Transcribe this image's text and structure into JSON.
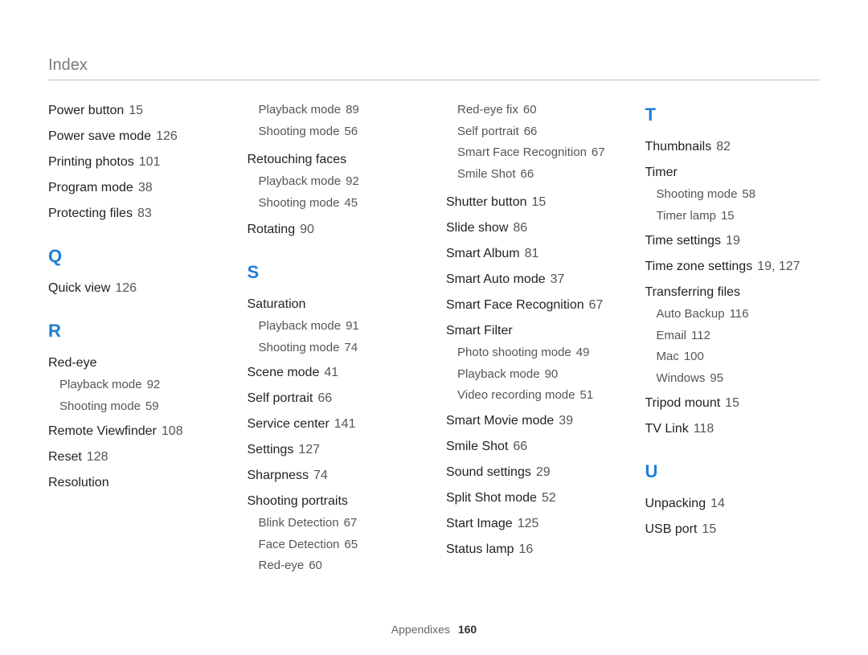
{
  "header": {
    "title": "Index"
  },
  "footer": {
    "section": "Appendixes",
    "page": "160"
  },
  "col1": {
    "entries_before_q": [
      {
        "label": "Power button",
        "page": "15"
      },
      {
        "label": "Power save mode",
        "page": "126"
      },
      {
        "label": "Printing photos",
        "page": "101"
      },
      {
        "label": "Program mode",
        "page": "38"
      },
      {
        "label": "Protecting files",
        "page": "83"
      }
    ],
    "letter_q": "Q",
    "q_entries": [
      {
        "label": "Quick view",
        "page": "126"
      }
    ],
    "letter_r": "R",
    "r_group1": {
      "head": "Red-eye",
      "subs": [
        {
          "label": "Playback mode",
          "page": "92"
        },
        {
          "label": "Shooting mode",
          "page": "59"
        }
      ]
    },
    "r_entries": [
      {
        "label": "Remote Viewfinder",
        "page": "108"
      },
      {
        "label": "Reset",
        "page": "128"
      },
      {
        "label": "Resolution",
        "page": ""
      }
    ]
  },
  "col2": {
    "top_subs": [
      {
        "label": "Playback mode",
        "page": "89"
      },
      {
        "label": "Shooting mode",
        "page": "56"
      }
    ],
    "retouch": {
      "head": "Retouching faces",
      "subs": [
        {
          "label": "Playback mode",
          "page": "92"
        },
        {
          "label": "Shooting mode",
          "page": "45"
        }
      ]
    },
    "rotating": {
      "label": "Rotating",
      "page": "90"
    },
    "letter_s": "S",
    "saturation": {
      "head": "Saturation",
      "subs": [
        {
          "label": "Playback mode",
          "page": "91"
        },
        {
          "label": "Shooting mode",
          "page": "74"
        }
      ]
    },
    "s_entries": [
      {
        "label": "Scene mode",
        "page": "41"
      },
      {
        "label": "Self portrait",
        "page": "66"
      },
      {
        "label": "Service center",
        "page": "141"
      },
      {
        "label": "Settings",
        "page": "127"
      },
      {
        "label": "Sharpness",
        "page": "74"
      }
    ],
    "portraits": {
      "head": "Shooting portraits",
      "subs": [
        {
          "label": "Blink Detection",
          "page": "67"
        },
        {
          "label": "Face Detection",
          "page": "65"
        },
        {
          "label": "Red-eye",
          "page": "60"
        }
      ]
    }
  },
  "col3": {
    "top_subs": [
      {
        "label": "Red-eye fix",
        "page": "60"
      },
      {
        "label": "Self portrait",
        "page": "66"
      },
      {
        "label": "Smart Face Recognition",
        "page": "67"
      },
      {
        "label": "Smile Shot",
        "page": "66"
      }
    ],
    "entries1": [
      {
        "label": "Shutter button",
        "page": "15"
      },
      {
        "label": "Slide show",
        "page": "86"
      },
      {
        "label": "Smart Album",
        "page": "81"
      },
      {
        "label": "Smart Auto mode",
        "page": "37"
      },
      {
        "label": "Smart Face Recognition",
        "page": "67"
      }
    ],
    "smartfilter": {
      "head": "Smart Filter",
      "subs": [
        {
          "label": "Photo shooting mode",
          "page": "49"
        },
        {
          "label": "Playback mode",
          "page": "90"
        },
        {
          "label": "Video recording mode",
          "page": "51"
        }
      ]
    },
    "entries2": [
      {
        "label": "Smart Movie mode",
        "page": "39"
      },
      {
        "label": "Smile Shot",
        "page": "66"
      },
      {
        "label": "Sound settings",
        "page": "29"
      },
      {
        "label": "Split Shot mode",
        "page": "52"
      },
      {
        "label": "Start Image",
        "page": "125"
      },
      {
        "label": "Status lamp",
        "page": "16"
      }
    ]
  },
  "col4": {
    "letter_t": "T",
    "thumbnails": {
      "label": "Thumbnails",
      "page": "82"
    },
    "timer": {
      "head": "Timer",
      "subs": [
        {
          "label": "Shooting mode",
          "page": "58"
        },
        {
          "label": "Timer lamp",
          "page": "15"
        }
      ]
    },
    "t_entries": [
      {
        "label": "Time settings",
        "page": "19"
      },
      {
        "label": "Time zone settings",
        "page": "19, 127"
      }
    ],
    "transfer": {
      "head": "Transferring files",
      "subs": [
        {
          "label": "Auto Backup",
          "page": "116"
        },
        {
          "label": "Email",
          "page": "112"
        },
        {
          "label": "Mac",
          "page": "100"
        },
        {
          "label": "Windows",
          "page": "95"
        }
      ]
    },
    "t_entries2": [
      {
        "label": "Tripod mount",
        "page": "15"
      },
      {
        "label": "TV Link",
        "page": "118"
      }
    ],
    "letter_u": "U",
    "u_entries": [
      {
        "label": "Unpacking",
        "page": "14"
      },
      {
        "label": "USB port",
        "page": "15"
      }
    ]
  }
}
